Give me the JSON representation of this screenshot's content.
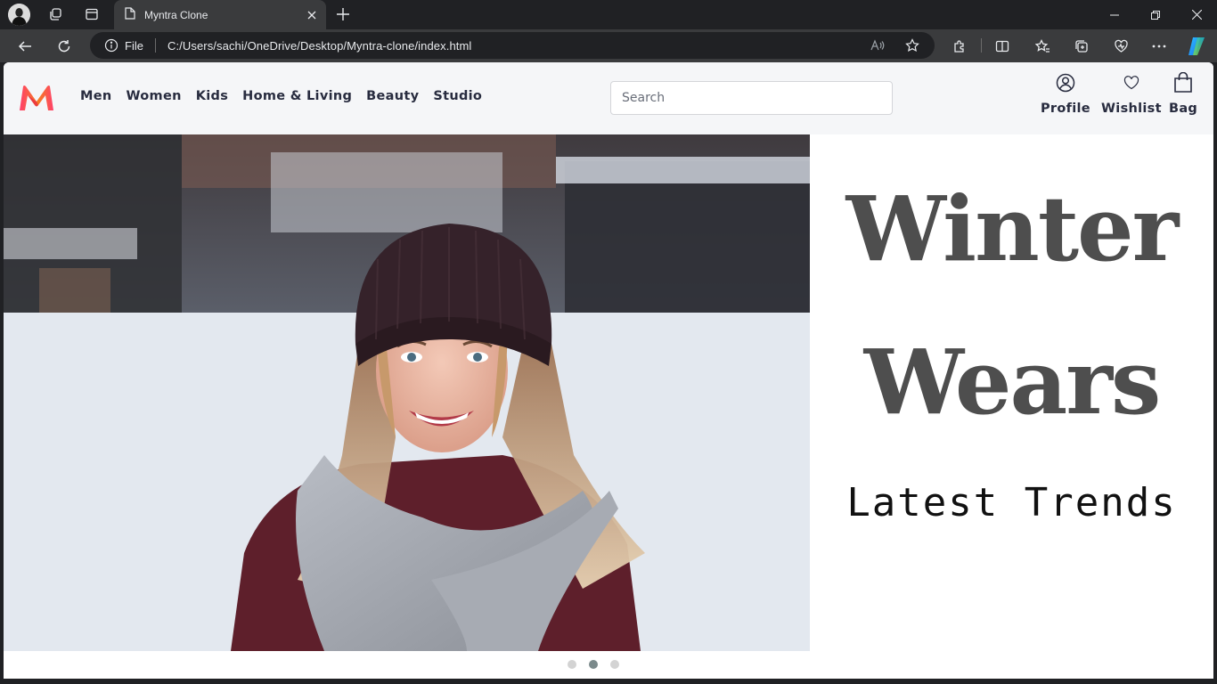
{
  "browser": {
    "tab_title": "Myntra Clone",
    "address_prefix": "File",
    "address_url": "C:/Users/sachi/OneDrive/Desktop/Myntra-clone/index.html"
  },
  "site": {
    "nav": [
      "Men",
      "Women",
      "Kids",
      "Home & Living",
      "Beauty",
      "Studio"
    ],
    "search_placeholder": "Search",
    "actions": {
      "profile": "Profile",
      "wishlist": "Wishlist",
      "bag": "Bag"
    }
  },
  "banner": {
    "headline_1": "Winter",
    "headline_2": "Wears",
    "subline": "Latest Trends",
    "slides": 3,
    "active_slide": 2
  },
  "colors": {
    "header_bg": "#f5f6f8",
    "headline": "#4e4e4e",
    "logo_pink": "#ff3f6c",
    "logo_orange": "#f57c1f"
  }
}
